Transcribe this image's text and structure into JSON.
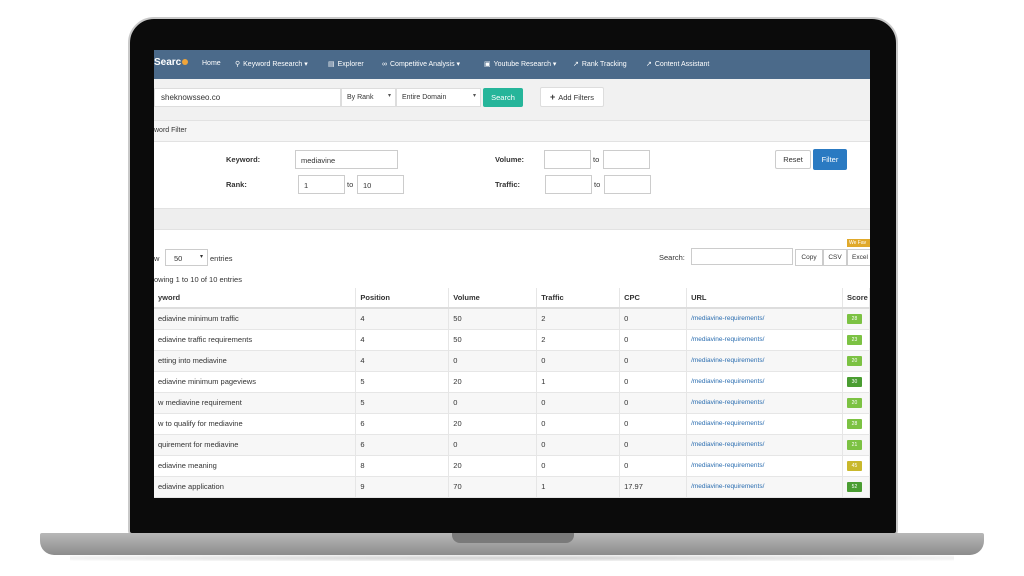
{
  "nav": {
    "logo": "Searc",
    "items": [
      {
        "label": "Home",
        "icon": ""
      },
      {
        "label": "Keyword Research ▾",
        "icon": "search-icon"
      },
      {
        "label": "Explorer",
        "icon": "bar-chart-icon"
      },
      {
        "label": "Competitive Analysis ▾",
        "icon": "link-icon"
      },
      {
        "label": "Youtube Research ▾",
        "icon": "video-icon"
      },
      {
        "label": "Rank Tracking",
        "icon": "line-chart-icon"
      },
      {
        "label": "Content Assistant",
        "icon": "line-chart-icon"
      }
    ]
  },
  "search": {
    "domain": "sheknowsseo.co",
    "rank_select": "By Rank",
    "scope_select": "Entire Domain",
    "search_label": "Search",
    "add_filters_label": "Add Filters"
  },
  "filter": {
    "header": "word Filter",
    "keyword_label": "Keyword:",
    "keyword_value": "mediavine",
    "rank_label": "Rank:",
    "rank_from": "1",
    "rank_to": "10",
    "to_label": "to",
    "volume_label": "Volume:",
    "traffic_label": "Traffic:",
    "reset_label": "Reset",
    "filter_label": "Filter"
  },
  "table_controls": {
    "fav_badge": "We Fav",
    "show_label": "w",
    "entries_value": "50",
    "entries_label": "entries",
    "search_label": "Search:",
    "copy_label": "Copy",
    "csv_label": "CSV",
    "excel_label": "Excel",
    "showing": "owing 1 to 10 of 10 entries"
  },
  "table": {
    "headers": [
      "yword",
      "Position",
      "Volume",
      "Traffic",
      "CPC",
      "URL",
      "Score"
    ],
    "rows": [
      {
        "keyword": "ediavine minimum traffic",
        "position": "4",
        "volume": "50",
        "traffic": "2",
        "cpc": "0",
        "url": "/mediavine-requirements/",
        "score": "28",
        "score_color": "#7cc243"
      },
      {
        "keyword": "ediavine traffic requirements",
        "position": "4",
        "volume": "50",
        "traffic": "2",
        "cpc": "0",
        "url": "/mediavine-requirements/",
        "score": "23",
        "score_color": "#7cc243"
      },
      {
        "keyword": "etting into mediavine",
        "position": "4",
        "volume": "0",
        "traffic": "0",
        "cpc": "0",
        "url": "/mediavine-requirements/",
        "score": "20",
        "score_color": "#7cc243"
      },
      {
        "keyword": "ediavine minimum pageviews",
        "position": "5",
        "volume": "20",
        "traffic": "1",
        "cpc": "0",
        "url": "/mediavine-requirements/",
        "score": "30",
        "score_color": "#4a9d32"
      },
      {
        "keyword": "w mediavine requirement",
        "position": "5",
        "volume": "0",
        "traffic": "0",
        "cpc": "0",
        "url": "/mediavine-requirements/",
        "score": "20",
        "score_color": "#7cc243"
      },
      {
        "keyword": "w to qualify for mediavine",
        "position": "6",
        "volume": "20",
        "traffic": "0",
        "cpc": "0",
        "url": "/mediavine-requirements/",
        "score": "28",
        "score_color": "#7cc243"
      },
      {
        "keyword": "quirement for mediavine",
        "position": "6",
        "volume": "0",
        "traffic": "0",
        "cpc": "0",
        "url": "/mediavine-requirements/",
        "score": "21",
        "score_color": "#7cc243"
      },
      {
        "keyword": "ediavine meaning",
        "position": "8",
        "volume": "20",
        "traffic": "0",
        "cpc": "0",
        "url": "/mediavine-requirements/",
        "score": "45",
        "score_color": "#c9b82c"
      },
      {
        "keyword": "ediavine application",
        "position": "9",
        "volume": "70",
        "traffic": "1",
        "cpc": "17.97",
        "url": "/mediavine-requirements/",
        "score": "52",
        "score_color": "#4a9d32"
      }
    ]
  }
}
